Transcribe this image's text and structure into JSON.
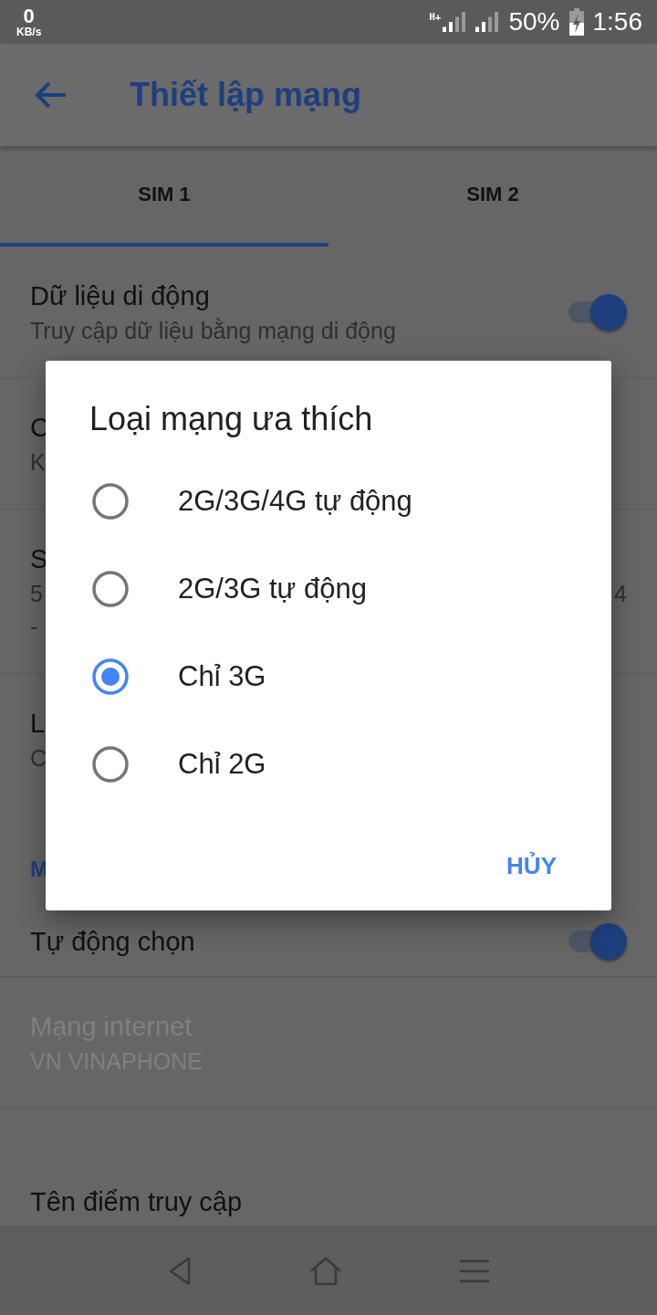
{
  "status_bar": {
    "speed_value": "0",
    "speed_unit": "KB/s",
    "network_type": "H+",
    "battery": "50%",
    "time": "1:56"
  },
  "app_bar": {
    "title": "Thiết lập mạng"
  },
  "tabs": [
    {
      "label": "SIM 1",
      "selected": true
    },
    {
      "label": "SIM 2",
      "selected": false
    }
  ],
  "settings": [
    {
      "kind": "switch",
      "title": "Dữ liệu di động",
      "subtitle": "Truy cập dữ liệu bằng mạng di động",
      "on": true,
      "disabled": false
    },
    {
      "kind": "text",
      "title": "C",
      "subtitle": "K",
      "disabled": false
    },
    {
      "kind": "text",
      "title": "S",
      "subtitle": "5",
      "subtitle_end": "4",
      "subtitle_2": "-",
      "disabled": false
    },
    {
      "kind": "text",
      "title": "L",
      "subtitle": "C",
      "disabled": false
    },
    {
      "kind": "header",
      "title": "M"
    },
    {
      "kind": "switch",
      "title": "Tự động chọn",
      "on": true,
      "disabled": false
    },
    {
      "kind": "text",
      "title": "Mạng internet",
      "subtitle": "VN VINAPHONE",
      "disabled": true
    },
    {
      "kind": "text",
      "title": "Tên điểm truy cập",
      "disabled": false
    }
  ],
  "dialog": {
    "title": "Loại mạng ưa thích",
    "options": [
      {
        "label": "2G/3G/4G tự động",
        "selected": false
      },
      {
        "label": "2G/3G tự động",
        "selected": false
      },
      {
        "label": "Chỉ 3G",
        "selected": true
      },
      {
        "label": "Chỉ 2G",
        "selected": false
      }
    ],
    "cancel": "HỦY"
  }
}
